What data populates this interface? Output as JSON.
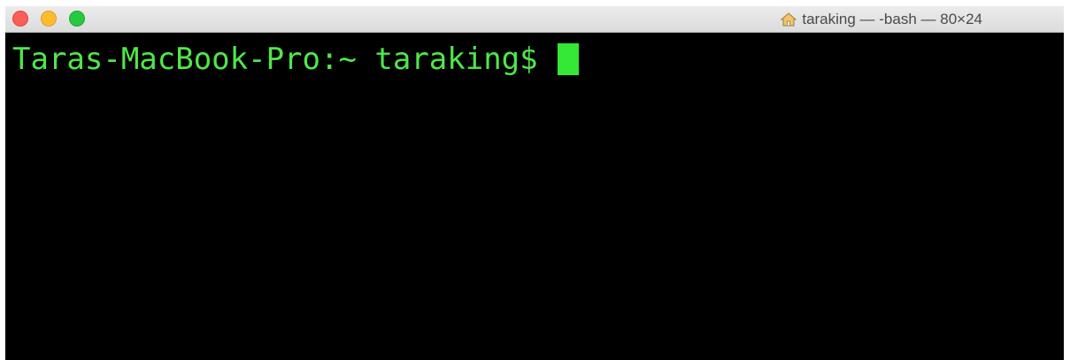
{
  "window": {
    "title": "taraking — -bash — 80×24",
    "title_icon": "home-icon",
    "traffic_lights": [
      "close",
      "minimize",
      "zoom"
    ]
  },
  "terminal": {
    "prompt": "Taras-MacBook-Pro:~ taraking$ ",
    "foreground_color": "#4fe74a",
    "background_color": "#000000",
    "cursor_color": "#35e835"
  }
}
